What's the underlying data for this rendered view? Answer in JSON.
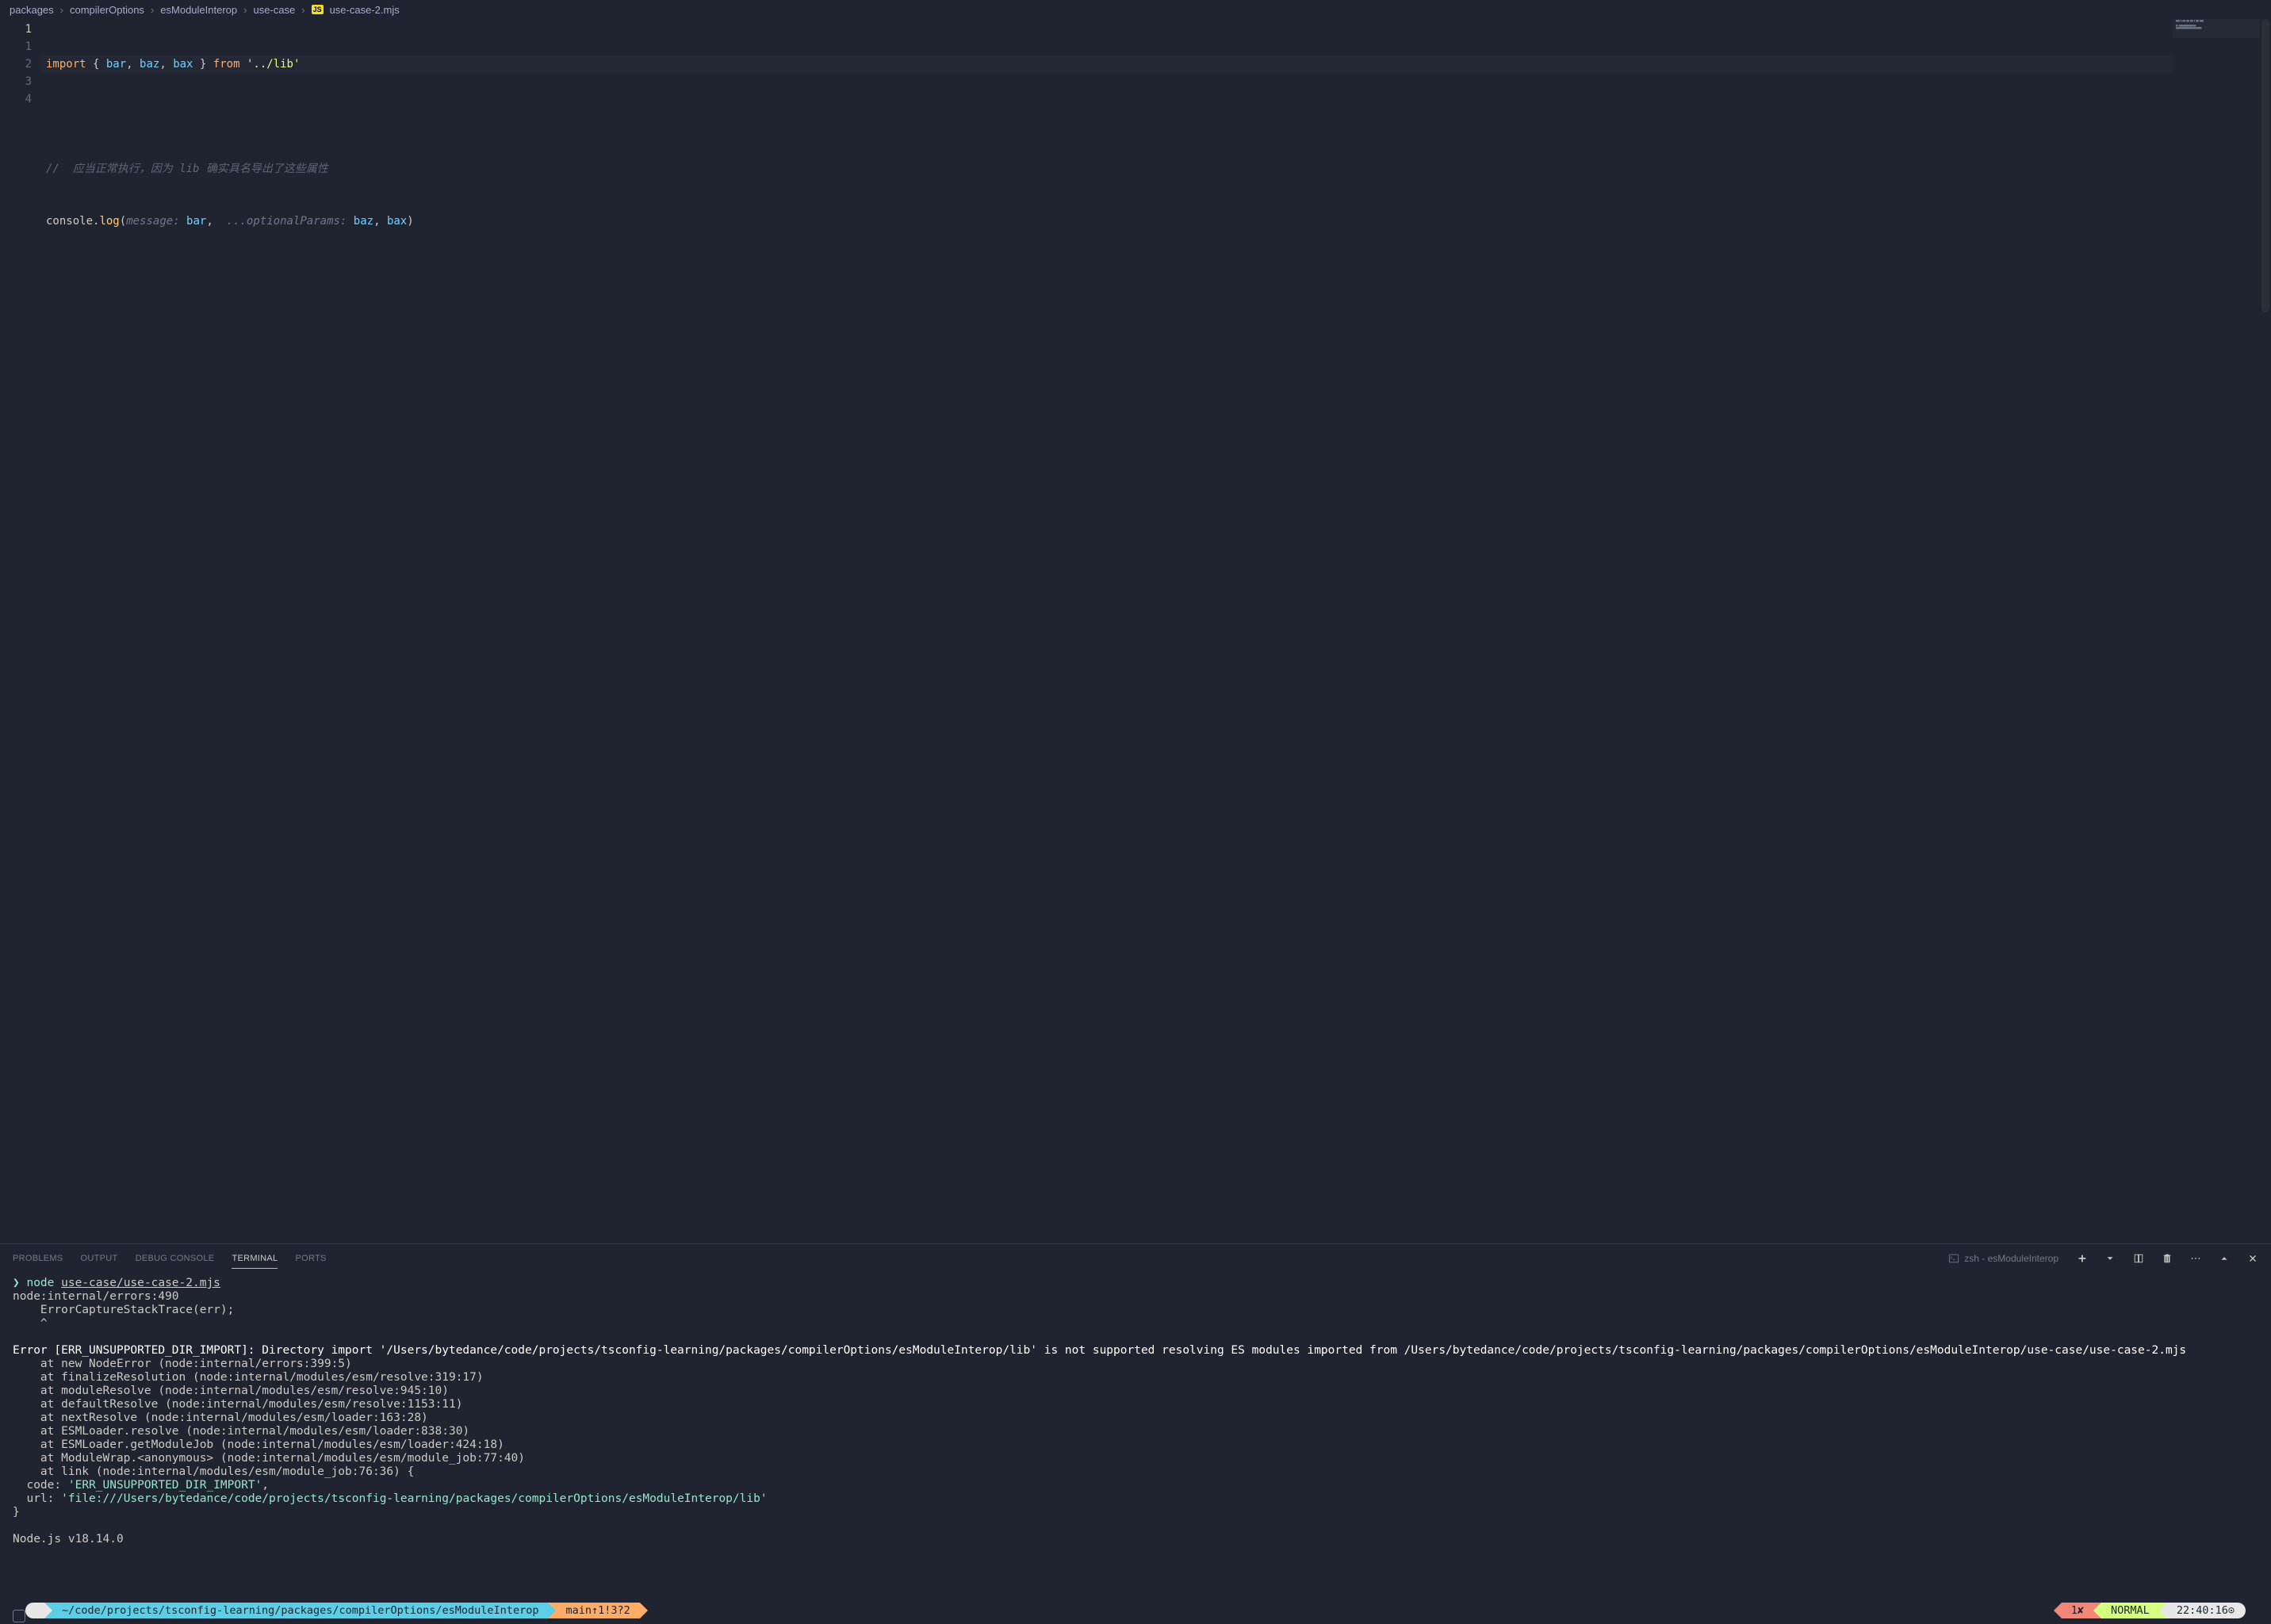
{
  "breadcrumb": {
    "crumbs": [
      "packages",
      "compilerOptions",
      "esModuleInterop",
      "use-case"
    ],
    "file_icon": "JS",
    "file": "use-case-2.mjs"
  },
  "editor": {
    "line_numbers": [
      "1",
      "1",
      "2",
      "3",
      "4"
    ],
    "line1": {
      "import": "import",
      "lbrace": " { ",
      "bar": "bar",
      "c1": ", ",
      "baz": "baz",
      "c2": ", ",
      "bax": "bax",
      "rbrace": " } ",
      "from": "from",
      "sp": " ",
      "path": "'../lib'"
    },
    "line3_comment": "//  应当正常执行，因为 lib 确实具名导出了这些属性",
    "line4": {
      "console": "console",
      "dot": ".",
      "log": "log",
      "lparen": "(",
      "p_message": "message: ",
      "bar": "bar",
      "comma1": ", ",
      "spread": " ...",
      "p_optional": "optionalParams: ",
      "baz": "baz",
      "comma2": ", ",
      "bax": "bax",
      "rparen": ")"
    }
  },
  "panel": {
    "tabs": {
      "problems": "PROBLEMS",
      "output": "OUTPUT",
      "debug": "DEBUG CONSOLE",
      "terminal": "TERMINAL",
      "ports": "PORTS"
    },
    "terminal_label": "zsh - esModuleInterop",
    "terminal": {
      "prompt": "❯",
      "cmd_node": "node",
      "cmd_arg": "use-case/use-case-2.mjs",
      "out1": "node:internal/errors:490",
      "out2": "    ErrorCaptureStackTrace(err);",
      "out3": "    ^",
      "blank": "",
      "err_line": "Error [ERR_UNSUPPORTED_DIR_IMPORT]: Directory import '/Users/bytedance/code/projects/tsconfig-learning/packages/compilerOptions/esModuleInterop/lib' is not supported resolving ES modules imported from /Users/bytedance/code/projects/tsconfig-learning/packages/compilerOptions/esModuleInterop/use-case/use-case-2.mjs",
      "st1": "    at new NodeError (node:internal/errors:399:5)",
      "st2": "    at finalizeResolution (node:internal/modules/esm/resolve:319:17)",
      "st3": "    at moduleResolve (node:internal/modules/esm/resolve:945:10)",
      "st4": "    at defaultResolve (node:internal/modules/esm/resolve:1153:11)",
      "st5": "    at nextResolve (node:internal/modules/esm/loader:163:28)",
      "st6": "    at ESMLoader.resolve (node:internal/modules/esm/loader:838:30)",
      "st7": "    at ESMLoader.getModuleJob (node:internal/modules/esm/loader:424:18)",
      "st8": "    at ModuleWrap.<anonymous> (node:internal/modules/esm/module_job:77:40)",
      "st9": "    at link (node:internal/modules/esm/module_job:76:36) {",
      "code_label": "  code: ",
      "code_val": "'ERR_UNSUPPORTED_DIR_IMPORT'",
      "code_comma": ",",
      "url_label": "  url: ",
      "url_val": "'file:///Users/bytedance/code/projects/tsconfig-learning/packages/compilerOptions/esModuleInterop/lib'",
      "close_brace": "}",
      "blank2": "",
      "node_ver": "Node.js v18.14.0"
    }
  },
  "powerline": {
    "apple": "",
    "folder": "",
    "path": "~/code/projects/tsconfig-learning/packages/compilerOptions/esModuleInterop",
    "git_icon": "  ",
    "branch": "main",
    "ahead": "↑1",
    "dirty": "!3",
    "untracked": "?2",
    "err_count": "1",
    "err_x": "✘",
    "mode": "NORMAL",
    "time": "22:40:16",
    "clock": "⊙"
  }
}
